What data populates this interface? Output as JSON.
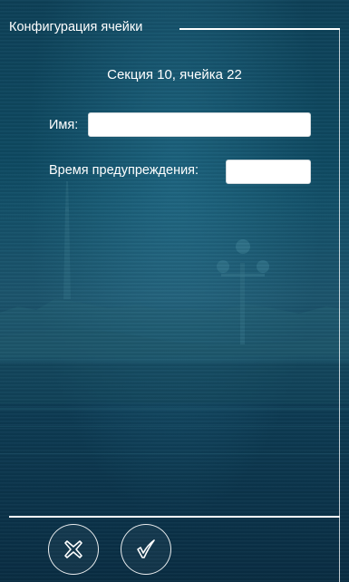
{
  "window": {
    "title": "Конфигурация ячейки"
  },
  "section_label": "Секция 10, ячейка 22",
  "form": {
    "name_label": "Имя:",
    "name_value": "",
    "warning_time_label": "Время предупреждения:",
    "warning_time_value": ""
  },
  "buttons": {
    "cancel_icon": "cancel-x-icon",
    "confirm_icon": "checkmark-icon"
  },
  "colors": {
    "background": "#0e4259",
    "text": "#ffffff",
    "input_bg": "#ffffff"
  }
}
